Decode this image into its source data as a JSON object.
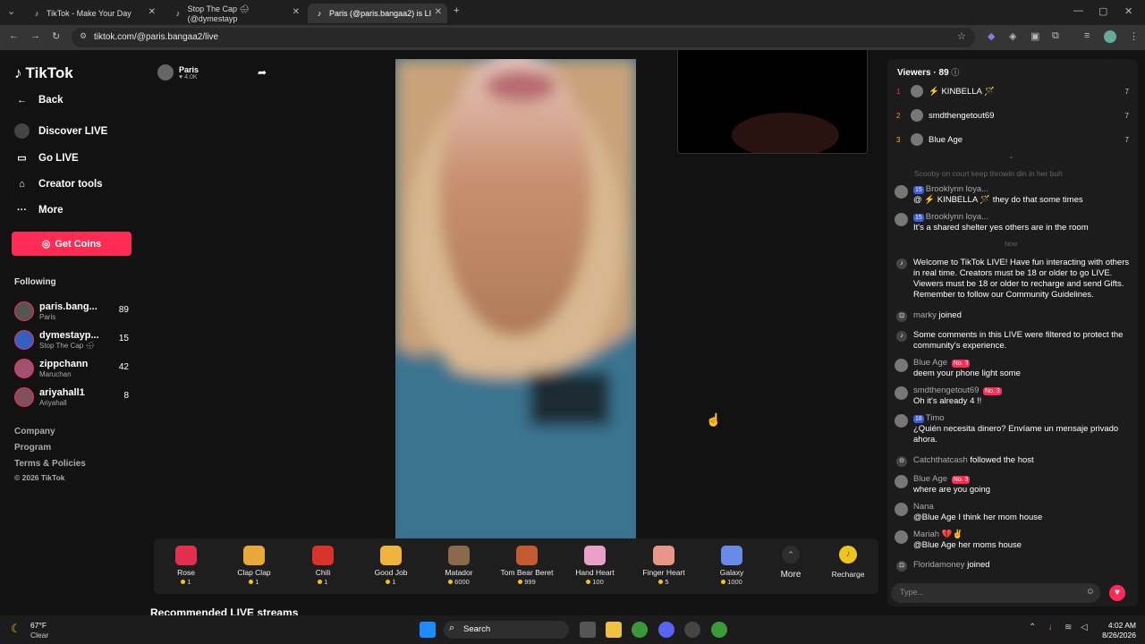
{
  "browser": {
    "tabs": [
      {
        "label": "TikTok - Make Your Day"
      },
      {
        "label": "Stop The Cap 🌧 (@dymestayp"
      },
      {
        "label": "Paris (@paris.bangaa2) is LI"
      }
    ],
    "url": "tiktok.com/@paris.bangaa2/live"
  },
  "sidebar": {
    "logo": "TikTok",
    "back": "Back",
    "nav": [
      "Discover LIVE",
      "Go LIVE",
      "Creator tools",
      "More"
    ],
    "get_coins": "Get Coins",
    "following_title": "Following",
    "following": [
      {
        "name": "paris.bang...",
        "sub": "Paris",
        "count": "89"
      },
      {
        "name": "dymestayp...",
        "sub": "Stop The Cap 🌧",
        "count": "15"
      },
      {
        "name": "zippchann",
        "sub": "Maruchan",
        "count": "42"
      },
      {
        "name": "ariyahall1",
        "sub": "Ariyahall",
        "count": "8"
      }
    ],
    "footer": [
      "Company",
      "Program",
      "Terms & Policies",
      "© 2026 TikTok"
    ]
  },
  "host": {
    "name": "Paris",
    "likes": "♥ 4.0K"
  },
  "gifts": [
    {
      "name": "Rose",
      "price": "1",
      "color": "#e0304e"
    },
    {
      "name": "Clap Clap",
      "price": "1",
      "color": "#e8a83a"
    },
    {
      "name": "Chili",
      "price": "1",
      "color": "#d9322b"
    },
    {
      "name": "Good Job",
      "price": "1",
      "color": "#f0b43c"
    },
    {
      "name": "Matador",
      "price": "6000",
      "color": "#8a6a4a"
    },
    {
      "name": "Tom Bear Beret",
      "price": "999",
      "color": "#c45a32"
    },
    {
      "name": "Hand Heart",
      "price": "100",
      "color": "#e8a0c8"
    },
    {
      "name": "Finger Heart",
      "price": "5",
      "color": "#e9968a"
    },
    {
      "name": "Galaxy",
      "price": "1000",
      "color": "#6a8ae8"
    }
  ],
  "gift_more": "More",
  "recharge": "Recharge",
  "recommended": "Recommended LIVE streams",
  "viewers": {
    "title": "Viewers · 89",
    "list": [
      {
        "rank": "1",
        "name": "⚡ KINBELLA 🪄",
        "score": "7"
      },
      {
        "rank": "2",
        "name": "smdthengetout69",
        "score": "7"
      },
      {
        "rank": "3",
        "name": "Blue Age",
        "score": "7"
      }
    ]
  },
  "chat": {
    "partial": "Scooby on court keep throwin din in her buh",
    "messages": [
      {
        "badge": "15",
        "user": "Brooklynn loya...",
        "text": "@ ⚡ KINBELLA 🪄 they do that some times"
      },
      {
        "badge": "15",
        "user": "Brooklynn loya...",
        "text": "It's a shared shelter yes others are in the room"
      }
    ],
    "divider": "Now",
    "welcome": "Welcome to TikTok LIVE! Have fun interacting with others in real time. Creators must be 18 or older to go LIVE. Viewers must be 18 or older to recharge and send Gifts. Remember to follow our Community Guidelines.",
    "join1_user": "marky",
    "join1_text": "joined",
    "filtered": "Some comments in this LIVE were filtered to protect the community's experience.",
    "messages2": [
      {
        "user": "Blue Age",
        "badge": "No. 3",
        "text": "deem your phone light some"
      },
      {
        "user": "smdthengetout69",
        "badge": "No. 3",
        "text": "Oh it's already 4 !!"
      },
      {
        "user": "Timo",
        "badge": "18",
        "text": "¿Quién necesita dinero? Envíame un mensaje privado ahora."
      }
    ],
    "follow_user": "Catchthatcash",
    "follow_text": "followed the host",
    "messages3": [
      {
        "user": "Blue Age",
        "badge": "No. 3",
        "text": "where are you going"
      },
      {
        "user": "Nana",
        "text": "@Blue Age I think her mom house"
      },
      {
        "user": "Mariah 💔✌",
        "text": "@Blue Age her moms house"
      }
    ],
    "join2_user": "Floridamoney",
    "join2_text": "joined",
    "placeholder": "Type..."
  },
  "taskbar": {
    "weather_temp": "67°F",
    "weather_desc": "Clear",
    "search": "Search",
    "time": "4:02 AM",
    "date": "8/26/2026"
  }
}
